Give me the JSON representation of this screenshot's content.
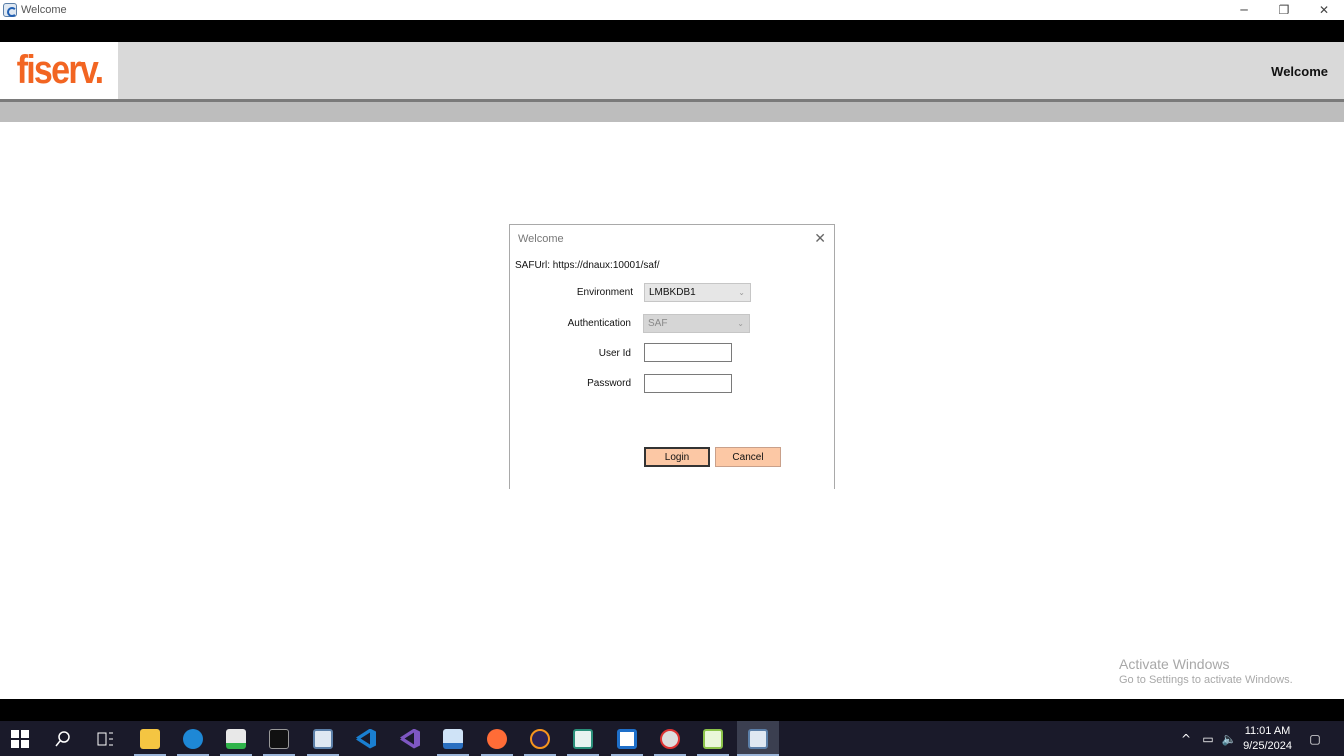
{
  "window": {
    "title": "Welcome",
    "controls": {
      "minimize": "─",
      "restore": "❐",
      "close": "✕"
    }
  },
  "header": {
    "logo_text": "fiserv.",
    "title": "Welcome"
  },
  "dialog": {
    "title": "Welcome",
    "close_glyph": "✕",
    "saf_url": "SAFUrl: https://dnaux:10001/saf/",
    "environment_label": "Environment",
    "environment_value": "LMBKDB1",
    "authentication_label": "Authentication",
    "authentication_value": "SAF",
    "user_id_label": "User Id",
    "user_id_value": "",
    "password_label": "Password",
    "password_value": "",
    "login_label": "Login",
    "cancel_label": "Cancel",
    "dropdown_arrow": "⌄"
  },
  "watermark": {
    "line1": "Activate Windows",
    "line2": "Go to Settings to activate Windows."
  },
  "taskbar": {
    "apps": [
      {
        "name": "start-button",
        "icon": "windows-logo"
      },
      {
        "name": "search-button",
        "icon": "search-icon"
      },
      {
        "name": "task-view-button",
        "icon": "task-view-icon"
      },
      {
        "name": "file-explorer",
        "icon": "folder-icon"
      },
      {
        "name": "edge",
        "icon": "edge-icon"
      },
      {
        "name": "app-green",
        "icon": "app-icon"
      },
      {
        "name": "terminal",
        "icon": "terminal-icon"
      },
      {
        "name": "app-welcome-1",
        "icon": "app-icon"
      },
      {
        "name": "vscode",
        "icon": "vscode-icon"
      },
      {
        "name": "visual-studio",
        "icon": "visual-studio-icon"
      },
      {
        "name": "app-doc",
        "icon": "document-icon"
      },
      {
        "name": "postman",
        "icon": "postman-icon"
      },
      {
        "name": "eclipse",
        "icon": "eclipse-icon"
      },
      {
        "name": "app-window-1",
        "icon": "window-icon"
      },
      {
        "name": "app-window-2",
        "icon": "window-icon"
      },
      {
        "name": "paint",
        "icon": "paint-icon"
      },
      {
        "name": "notepad-plus",
        "icon": "notepad-icon"
      },
      {
        "name": "welcome-active",
        "icon": "app-icon"
      }
    ],
    "tray": {
      "chevron": "^",
      "network": "▭",
      "volume": "🔈",
      "time": "11:01 AM",
      "date": "9/25/2024",
      "notifications": "▢"
    }
  },
  "colors": {
    "brand_orange": "#f26522",
    "button_fill": "#fcc8a5",
    "header_gray": "#d9d9d9"
  }
}
